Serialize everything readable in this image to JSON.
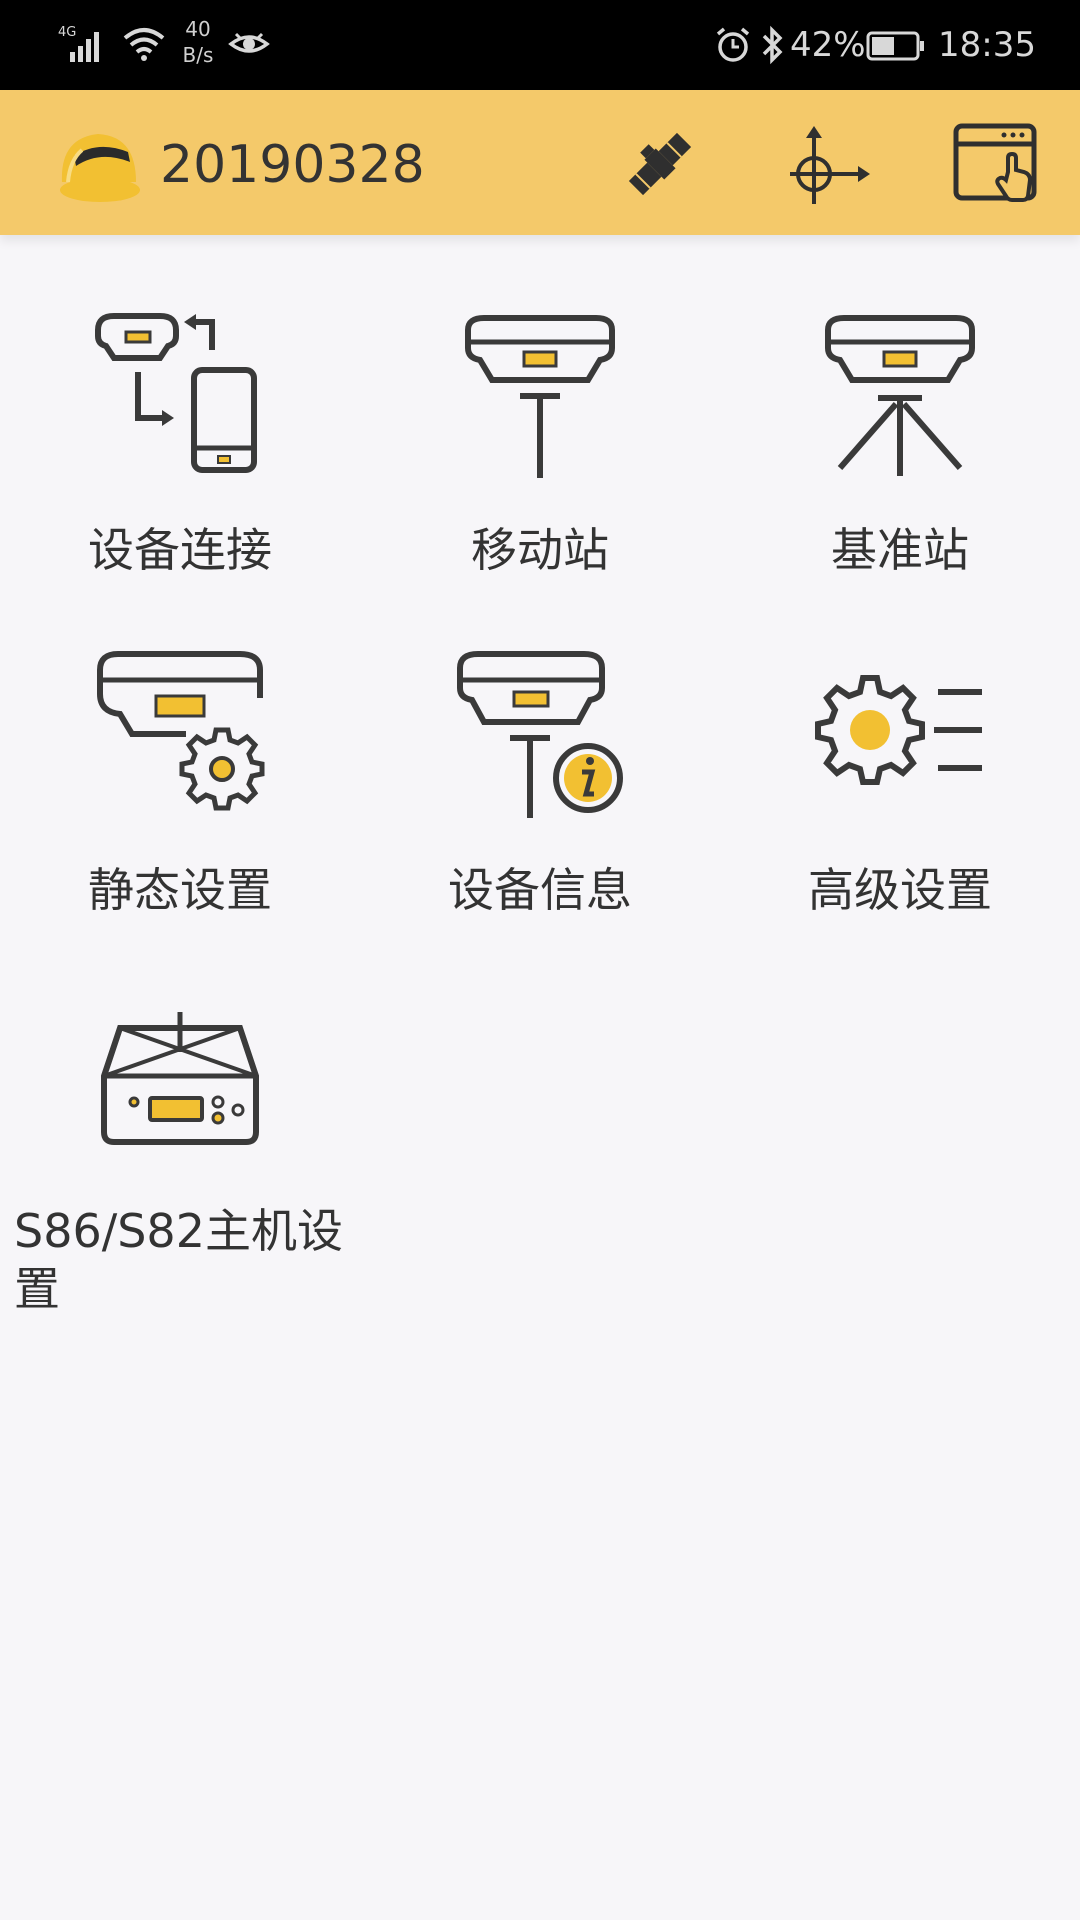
{
  "status_bar": {
    "network": "4G",
    "speed_value": "40",
    "speed_unit": "B/s",
    "battery_percent": "42%",
    "time": "18:35",
    "icons": [
      "signal-icon",
      "wifi-icon",
      "eye-icon",
      "alarm-icon",
      "bluetooth-icon",
      "battery-icon"
    ]
  },
  "toolbar": {
    "project_name": "20190328",
    "accent_color": "#f4c96a",
    "actions": [
      "satellite-icon",
      "target-icon",
      "window-pointer-icon"
    ]
  },
  "menu": {
    "items": [
      {
        "label": "设备连接",
        "icon": "device-connect-icon"
      },
      {
        "label": "移动站",
        "icon": "rover-icon"
      },
      {
        "label": "基准站",
        "icon": "base-station-icon"
      },
      {
        "label": "静态设置",
        "icon": "static-settings-icon"
      },
      {
        "label": "设备信息",
        "icon": "device-info-icon"
      },
      {
        "label": "高级设置",
        "icon": "advanced-settings-icon"
      },
      {
        "label": "S86/S82主机设置",
        "icon": "host-settings-icon"
      }
    ],
    "icon_stroke_color": "#3a3a3a",
    "icon_accent_color": "#f2c032"
  }
}
